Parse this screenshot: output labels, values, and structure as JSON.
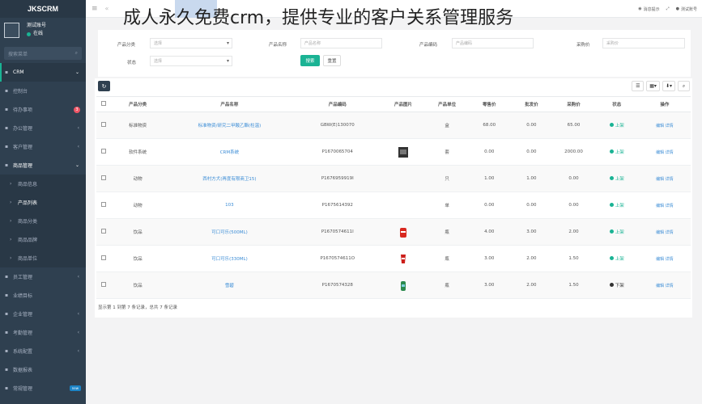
{
  "app": {
    "brand": "JKSCRM"
  },
  "profile": {
    "name": "测试账号",
    "status": "在线"
  },
  "sidebar": {
    "search_placeholder": "搜索菜单",
    "items": [
      {
        "icon": "home-icon",
        "label": "CRM",
        "state": "active"
      },
      {
        "icon": "dashboard-icon",
        "label": "控制台"
      },
      {
        "icon": "clock-icon",
        "label": "待办事项",
        "badge": "3"
      },
      {
        "icon": "briefcase-icon",
        "label": "办公管理"
      },
      {
        "icon": "user-icon",
        "label": "客户管理"
      },
      {
        "icon": "cart-icon",
        "label": "商品管理",
        "state": "open"
      },
      {
        "label": "商品信息",
        "sub": true
      },
      {
        "label": "产品列表",
        "sub": true,
        "state": "current"
      },
      {
        "label": "商品分类",
        "sub": true
      },
      {
        "label": "商品品牌",
        "sub": true
      },
      {
        "label": "商品单位",
        "sub": true
      },
      {
        "icon": "users-icon",
        "label": "员工管理"
      },
      {
        "icon": "chart-icon",
        "label": "业绩目标"
      },
      {
        "icon": "building-icon",
        "label": "企业管理"
      },
      {
        "icon": "calendar-icon",
        "label": "考勤管理"
      },
      {
        "icon": "gear-icon",
        "label": "系统配置"
      },
      {
        "icon": "database-icon",
        "label": "数据报表"
      },
      {
        "icon": "book-icon",
        "label": "常规管理",
        "badge_new": "new"
      }
    ]
  },
  "topbar": {
    "overlay_title": "成人永久免费crm，提供专业的客户关系管理服务",
    "right_items": [
      {
        "icon": "bell-icon",
        "label": "消息提示"
      },
      {
        "icon": "fullscreen-icon",
        "label": ""
      },
      {
        "icon": "user-icon",
        "label": "测试账号"
      }
    ]
  },
  "search_form": {
    "category": {
      "label": "产品分类",
      "value": "选择"
    },
    "name": {
      "label": "产品名称",
      "placeholder": "产品名称"
    },
    "code": {
      "label": "产品编码",
      "placeholder": "产品编码"
    },
    "price": {
      "label": "采购价",
      "placeholder": "采购价"
    },
    "status": {
      "label": "状态",
      "value": "选择"
    },
    "search_btn": "搜索",
    "reset_btn": "重置"
  },
  "table": {
    "columns": [
      "产品分类",
      "产品名称",
      "产品编码",
      "产品图片",
      "产品单位",
      "零售价",
      "批发价",
      "采购价",
      "状态",
      "操作"
    ],
    "rows": [
      {
        "category": "标准物资",
        "name": "标准物资/研究二甲酸乙酯(柱温)",
        "code": "GBW(E)130070",
        "image": "",
        "unit": "盒",
        "retail": "68.00",
        "wholesale": "0.00",
        "purchase": "65.00",
        "status": "上架",
        "status_color": "#1ab394",
        "ops": "编辑 详情"
      },
      {
        "category": "软件系统",
        "name": "CRM系统",
        "code": "P1670065704",
        "image": "dark",
        "unit": "套",
        "retail": "0.00",
        "wholesale": "0.00",
        "purchase": "2000.00",
        "status": "上架",
        "status_color": "#1ab394",
        "ops": "编辑 详情"
      },
      {
        "category": "动物",
        "name": "西村方犬(再度有限商卫15)",
        "code": "P1676959919I",
        "image": "",
        "unit": "只",
        "retail": "1.00",
        "wholesale": "1.00",
        "purchase": "0.00",
        "status": "上架",
        "status_color": "#1ab394",
        "ops": "编辑 详情"
      },
      {
        "category": "动物",
        "name": "103",
        "code": "P1675614392",
        "image": "",
        "unit": "单",
        "retail": "0.00",
        "wholesale": "0.00",
        "purchase": "0.00",
        "status": "上架",
        "status_color": "#1ab394",
        "ops": "编辑 详情"
      },
      {
        "category": "饮品",
        "name": "可口可乐(500ML)",
        "code": "P1670574611I",
        "image": "red",
        "unit": "瓶",
        "retail": "4.00",
        "wholesale": "3.00",
        "purchase": "2.00",
        "status": "上架",
        "status_color": "#1ab394",
        "ops": "编辑 详情"
      },
      {
        "category": "饮品",
        "name": "可口可乐(330ML)",
        "code": "P1670574611O",
        "image": "redcup",
        "unit": "瓶",
        "retail": "3.00",
        "wholesale": "2.00",
        "purchase": "1.50",
        "status": "上架",
        "status_color": "#1ab394",
        "ops": "编辑 详情"
      },
      {
        "category": "饮品",
        "name": "雪碧",
        "code": "P1670574328",
        "image": "green",
        "unit": "瓶",
        "retail": "3.00",
        "wholesale": "2.00",
        "purchase": "1.50",
        "status": "下架",
        "status_color": "#333333",
        "ops": "编辑 详情"
      }
    ],
    "footer": "显示第 1 到第 7 条记录，总共 7 条记录"
  }
}
